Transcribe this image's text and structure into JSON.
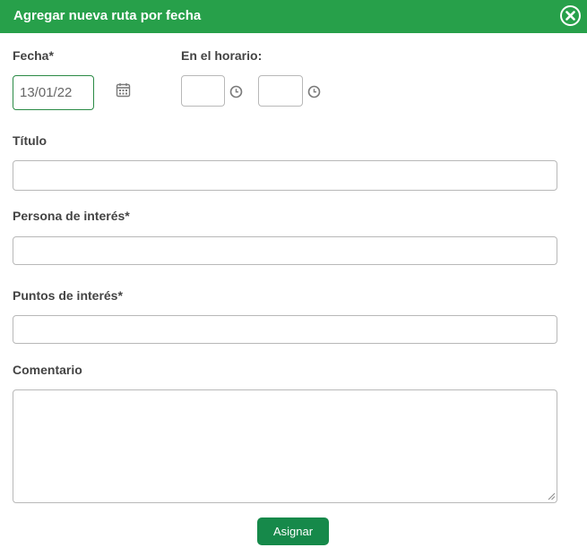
{
  "dialog": {
    "title": "Agregar nueva ruta por fecha",
    "close_icon": "close-circle-icon",
    "accent_color": "#27a04a"
  },
  "form": {
    "fecha": {
      "label": "Fecha*",
      "value": "13/01/22",
      "icon": "calendar-icon"
    },
    "horario": {
      "label": "En el horario:",
      "start_value": "",
      "end_value": "",
      "icon": "clock-icon"
    },
    "titulo": {
      "label": "Título",
      "value": ""
    },
    "persona": {
      "label": "Persona de interés*",
      "value": ""
    },
    "puntos": {
      "label": "Puntos de interés*",
      "value": ""
    },
    "comentario": {
      "label": "Comentario",
      "value": ""
    }
  },
  "actions": {
    "submit_label": "Asignar",
    "submit_color": "#16894a"
  }
}
